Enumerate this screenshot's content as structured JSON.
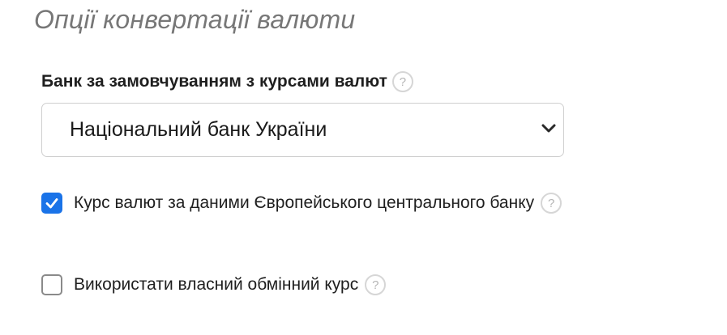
{
  "section": {
    "title": "Опції конвертації валюти"
  },
  "default_bank": {
    "label": "Банк за замовчуванням з курсами валют",
    "help_icon": "question-mark-icon",
    "selected_value": "Національний банк України",
    "dropdown_icon": "chevron-down-icon"
  },
  "options": {
    "ecb_rates": {
      "label": "Курс валют за даними Європейського центрального банку",
      "checked": true,
      "help_icon": "question-mark-icon"
    },
    "custom_rate": {
      "label": "Використати власний обмінний курс",
      "checked": false,
      "help_icon": "question-mark-icon"
    }
  },
  "help_glyph": "?",
  "colors": {
    "accent": "#1a73e8",
    "title": "#777777",
    "border": "#cfcfcf",
    "help_icon": "#b5b5b5"
  }
}
